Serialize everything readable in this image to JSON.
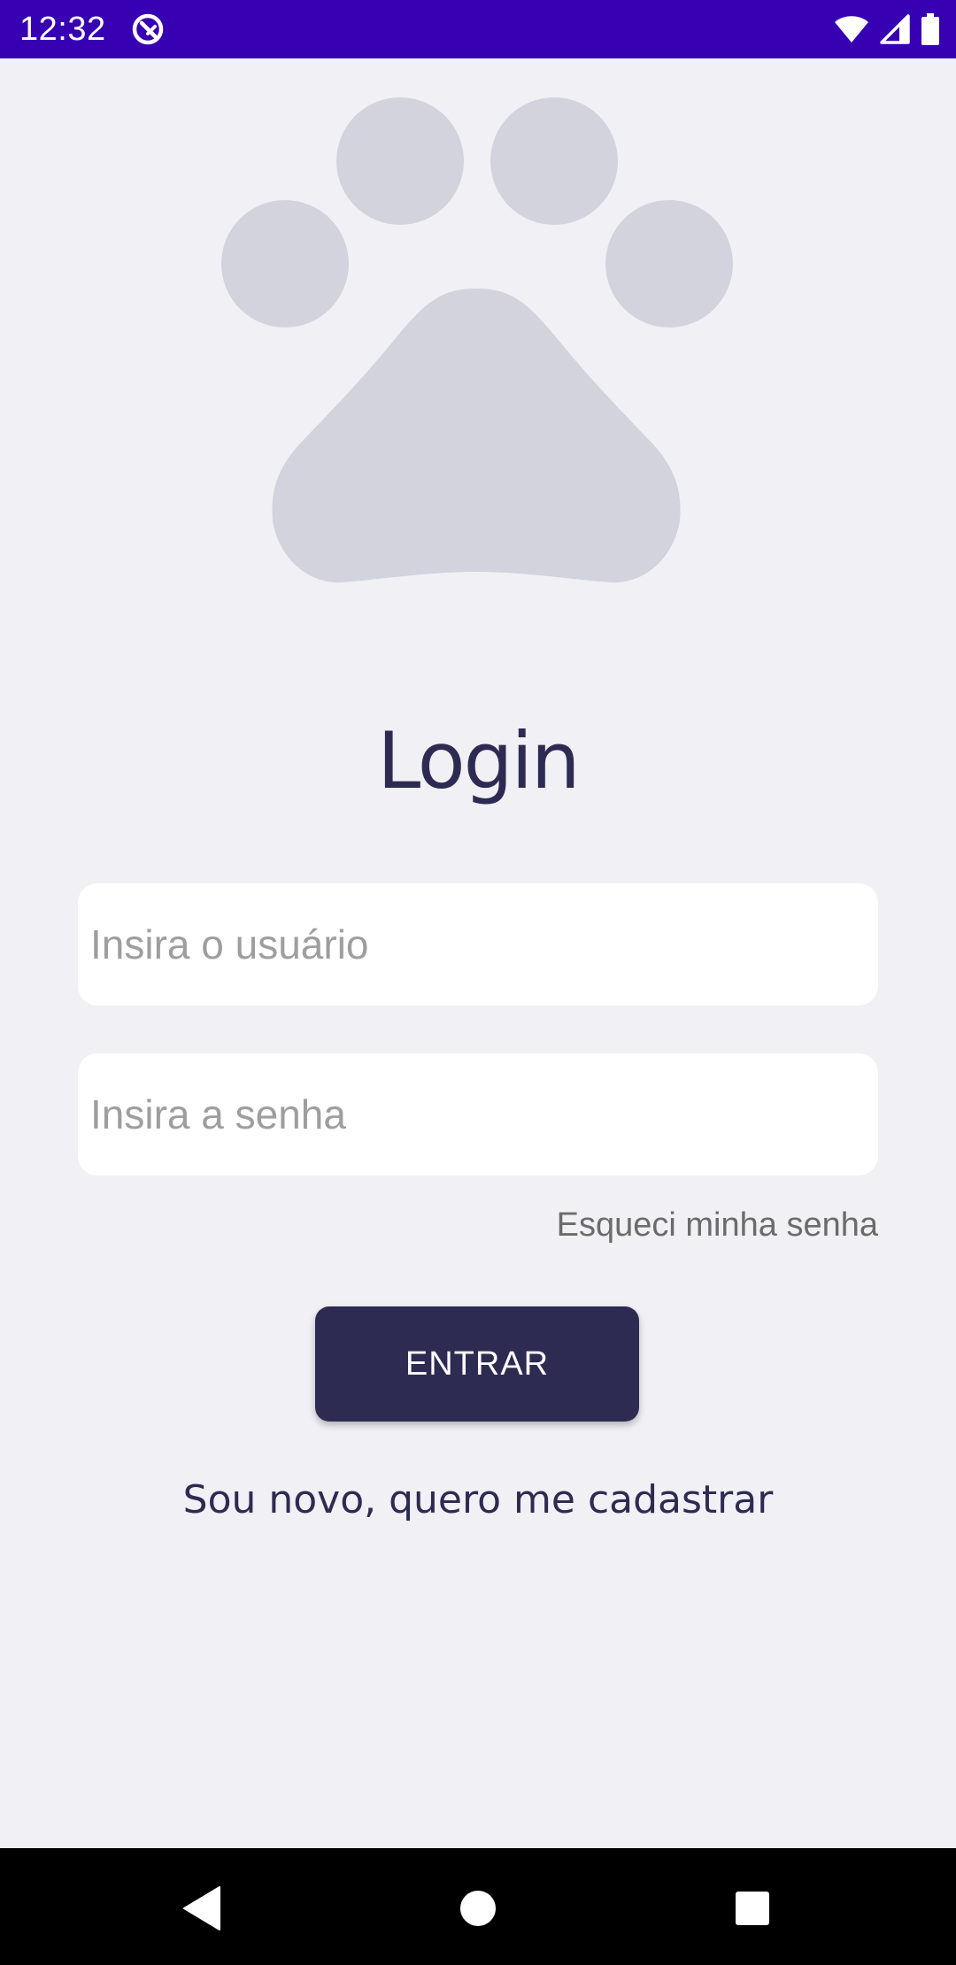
{
  "status_bar": {
    "time": "12:32",
    "icons": [
      "app-notification-icon",
      "wifi-icon",
      "signal-icon",
      "battery-icon"
    ],
    "background": "#3700B3"
  },
  "logo": {
    "icon": "paw-icon",
    "color": "#D3D3DE"
  },
  "login": {
    "title": "Login",
    "username_placeholder": "Insira o usuário",
    "password_placeholder": "Insira a senha",
    "forgot_password": "Esqueci minha senha",
    "enter_button": "ENTRAR",
    "register_link": "Sou novo, quero me cadastrar"
  },
  "theme": {
    "background": "#F0F0F5",
    "primary": "#2E2B52",
    "field_background": "#FFFFFF",
    "placeholder_color": "#9E9E9E"
  },
  "nav_bar": {
    "icons": [
      "back-icon",
      "home-icon",
      "recents-icon"
    ]
  }
}
